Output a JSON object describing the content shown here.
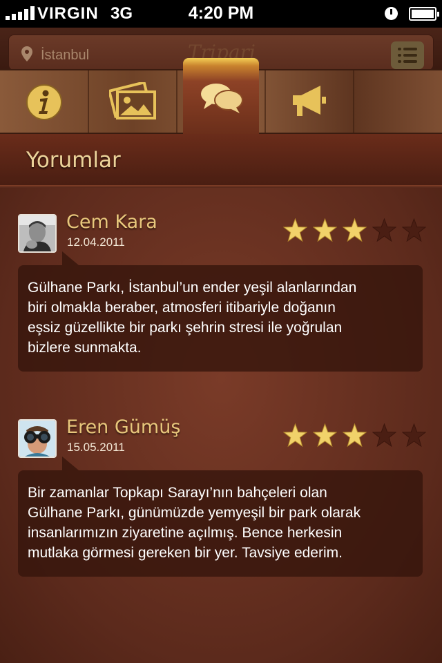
{
  "status_bar": {
    "carrier": "VIRGIN",
    "network": "3G",
    "time": "4:20 PM"
  },
  "header": {
    "location": "İstanbul",
    "logo_text": "Tripari"
  },
  "tabs": [
    {
      "icon": "info-icon"
    },
    {
      "icon": "gallery-icon"
    },
    {
      "icon": "comments-icon",
      "active": true
    },
    {
      "icon": "megaphone-icon"
    }
  ],
  "section": {
    "title": "Yorumlar"
  },
  "reviews": [
    {
      "name": "Cem Kara",
      "date": "12.04.2011",
      "rating": 3,
      "max_rating": 5,
      "text_lines": [
        "Gülhane Parkı, İstanbul’un ender yeşil alanlarından",
        "biri olmakla beraber, atmosferi itibariyle doğanın",
        "eşsiz güzellikte bir parkı şehrin stresi ile yoğrulan",
        "bizlere sunmakta."
      ]
    },
    {
      "name": "Eren Gümüş",
      "date": "15.05.2011",
      "rating": 3,
      "max_rating": 5,
      "text_lines": [
        "Bir zamanlar Topkapı Sarayı’nın bahçeleri olan",
        "Gülhane Parkı, günümüzde yemyeşil bir park olarak",
        "insanlarımızın ziyaretine açılmış. Bence herkesin",
        "mutlaka görmesi gereken bir yer. Tavsiye ederim."
      ]
    }
  ],
  "colors": {
    "gold": "#e8c77c",
    "star_on": "#f1d26a",
    "star_off": "#4a1e13"
  }
}
